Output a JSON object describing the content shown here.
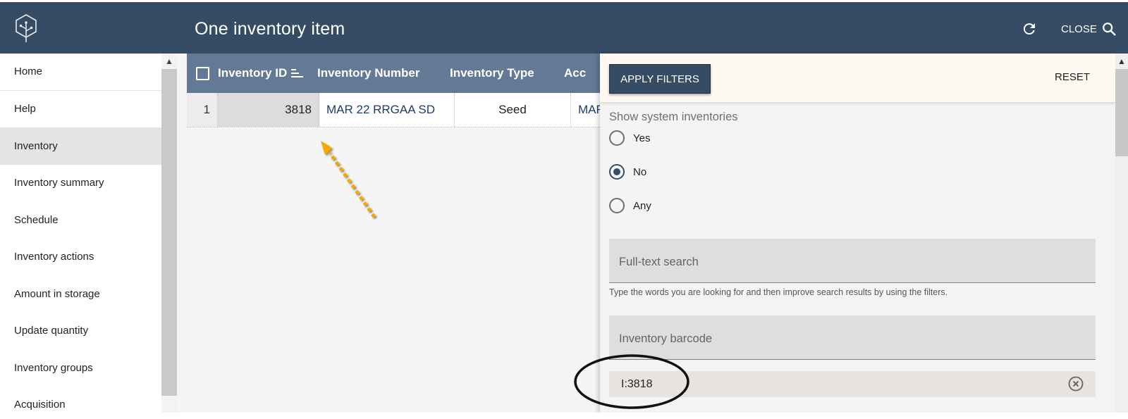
{
  "app": {
    "title": "One inventory item",
    "close_label": "CLOSE",
    "icons": {
      "logo": "tree-hexagon-logo",
      "refresh": "refresh-icon",
      "search": "search-icon"
    }
  },
  "sidebar": {
    "items": [
      {
        "label": "Home",
        "active": false
      },
      {
        "label": "Help",
        "active": false
      },
      {
        "label": "Inventory",
        "active": true
      },
      {
        "label": "Inventory summary",
        "active": false
      },
      {
        "label": "Schedule",
        "active": false
      },
      {
        "label": "Inventory actions",
        "active": false
      },
      {
        "label": "Amount in storage",
        "active": false
      },
      {
        "label": "Update quantity",
        "active": false
      },
      {
        "label": "Inventory groups",
        "active": false
      },
      {
        "label": "Acquisition",
        "active": false
      }
    ]
  },
  "grid": {
    "columns": [
      {
        "label": "Inventory ID",
        "sorted": true
      },
      {
        "label": "Inventory Number"
      },
      {
        "label": "Inventory Type"
      },
      {
        "label": "Acc"
      }
    ],
    "rows": [
      {
        "row_number": "1",
        "inventory_id": "3818",
        "inventory_number": "MAR 22 RRGAA SD",
        "inventory_type": "Seed",
        "accession": "MAR"
      }
    ]
  },
  "filters": {
    "apply_label": "APPLY FILTERS",
    "reset_label": "RESET",
    "system_inventories": {
      "label": "Show system inventories",
      "options": [
        {
          "label": "Yes",
          "checked": false
        },
        {
          "label": "No",
          "checked": true
        },
        {
          "label": "Any",
          "checked": false
        }
      ]
    },
    "fulltext": {
      "placeholder": "Full-text search",
      "hint": "Type the words you are looking for and then improve search results by using the filters."
    },
    "barcode": {
      "placeholder": "Inventory barcode",
      "value": "I:3818"
    }
  },
  "colors": {
    "appbar": "#364b64",
    "grid_header": "#637995",
    "link": "#1c3a6b",
    "annotation_arrow": "#f5a800",
    "panel_bar": "#fdf9f0"
  }
}
